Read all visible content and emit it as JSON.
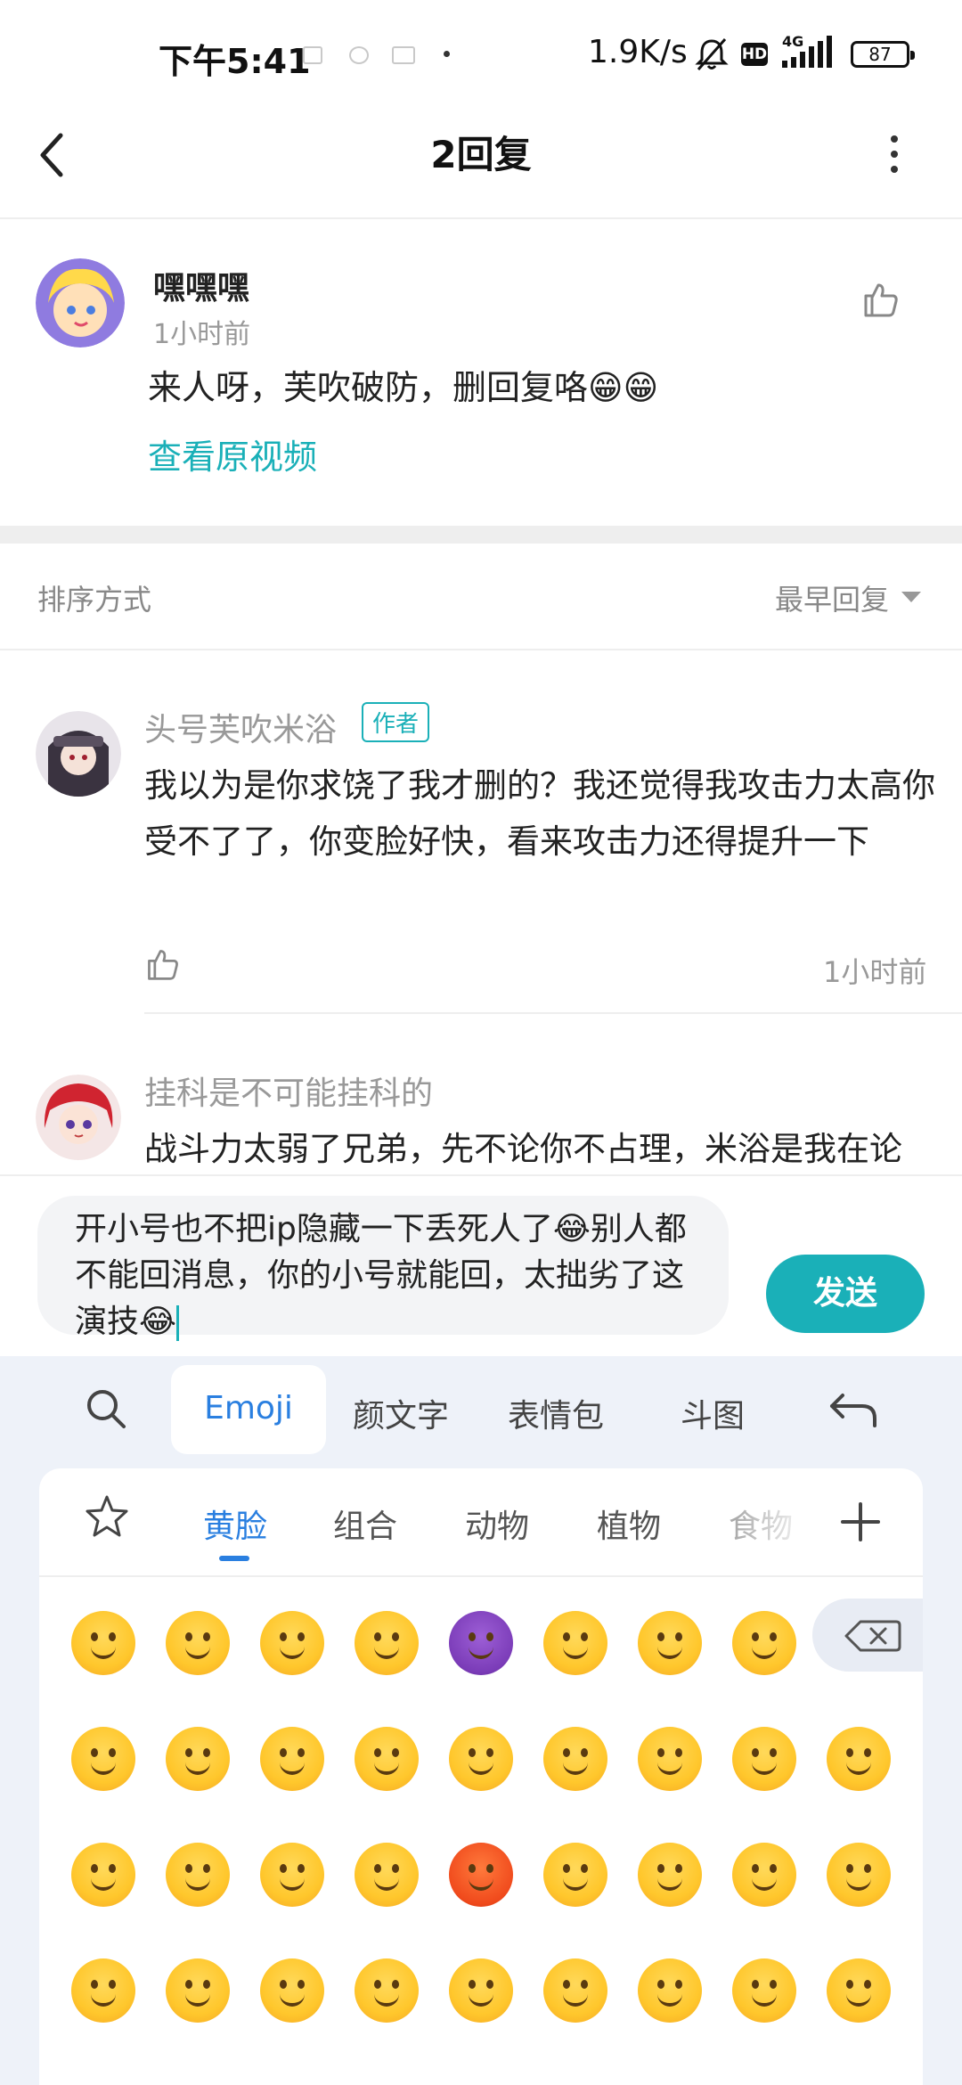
{
  "status_bar": {
    "time": "下午5:41",
    "network_speed": "1.9K/s",
    "hd": "HD",
    "network_type": "4G",
    "battery": "87"
  },
  "header": {
    "title": "2回复"
  },
  "original_comment": {
    "username": "嘿嘿嘿",
    "time": "1小时前",
    "text": "来人呀，芙吹破防，删回复咯😁😁",
    "view_video_link": "查看原视频"
  },
  "sort": {
    "label": "排序方式",
    "value": "最早回复"
  },
  "replies": [
    {
      "username": "头号芙吹米浴",
      "tag": "作者",
      "text": "我以为是你求饶了我才删的？我还觉得我攻击力太高你受不了了，你变脸好快，看来攻击力还得提升一下",
      "time": "1小时前"
    },
    {
      "username": "挂科是不可能挂科的",
      "text": "战斗力太弱了兄弟，先不论你不占理，米浴是我在论"
    }
  ],
  "input": {
    "text": "开小号也不把ip隐藏一下丢死人了😂别人都不能回消息，你的小号就能回，太拙劣了这演技😂",
    "send_label": "发送"
  },
  "keyboard": {
    "tabs": [
      "Emoji",
      "颜文字",
      "表情包",
      "斗图"
    ],
    "categories": [
      "黄脸",
      "组合",
      "动物",
      "植物",
      "食物"
    ],
    "emoji_rows": [
      [
        "grinning",
        "joy",
        "smiley",
        "grin",
        "imp",
        "wink",
        "blush",
        "relaxed"
      ],
      [
        "relieved",
        "heart-eyes",
        "smirk",
        "unamused",
        "sweat",
        "pensive",
        "confounded",
        "kissing-heart",
        "kissing-closed-eyes"
      ],
      [
        "stuck-out-tongue-winking",
        "stuck-out-tongue-closed",
        "disappointed",
        "angry",
        "rage",
        "cry",
        "persevere",
        "disappointed-relieved",
        "fearful"
      ],
      [
        "sleepy",
        "sob",
        "cold-sweat",
        "scream",
        "astonished",
        "flushed",
        "mask",
        "upside-down",
        "yum"
      ]
    ],
    "icons": {
      "search": "search-icon",
      "return": "return-icon",
      "favorites": "star-icon",
      "add": "plus-icon",
      "delete": "backspace-icon"
    }
  },
  "colors": {
    "accent": "#1ab0b8",
    "keyboard_blue": "#2a7fe0"
  }
}
